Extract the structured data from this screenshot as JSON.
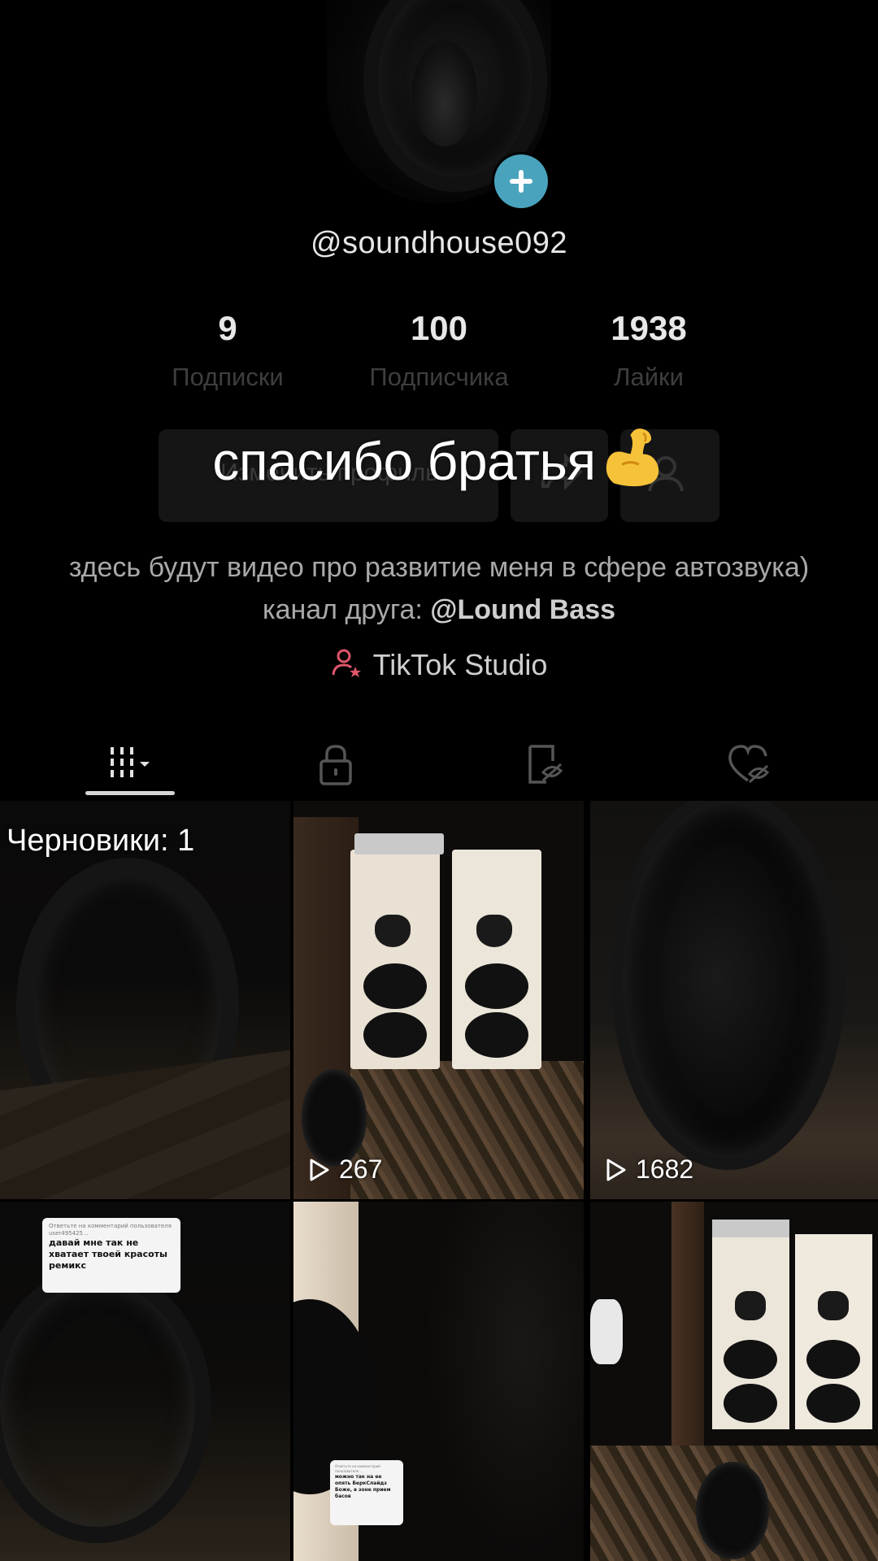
{
  "profile": {
    "username": "@soundhouse092",
    "stats": [
      {
        "value": "9",
        "label": "Подписки"
      },
      {
        "value": "100",
        "label": "Подписчика"
      },
      {
        "value": "1938",
        "label": "Лайки"
      }
    ],
    "edit_profile_label": "Изменить профиль",
    "overlay_caption": "спасибо братья",
    "bio_text": "здесь будут видео про развитие меня в сфере автозвука) канал друга: ",
    "bio_mention": "@Lound Bass",
    "studio_label": "TikTok Studio"
  },
  "tabs": [
    {
      "icon": "videos-grid-icon",
      "active": true
    },
    {
      "icon": "lock-icon",
      "active": false
    },
    {
      "icon": "reposts-icon",
      "active": false
    },
    {
      "icon": "liked-hidden-icon",
      "active": false
    }
  ],
  "grid": {
    "drafts_label": "Черновики: 1",
    "videos": [
      {
        "views": "267"
      },
      {
        "views": "1682"
      }
    ],
    "reply_card_1": {
      "header": "Ответьте на комментарий пользователя user495425...",
      "body": "давай мне так не хватает твоей красоты ремикс"
    },
    "reply_card_2": {
      "header": "Ответьте на комментарий пользователя ...",
      "body": "можно так на ее опять БеркСлайдз Боже, в зоне прием басов"
    }
  },
  "colors": {
    "background": "#000000",
    "add_badge": "#4aa3bd",
    "studio_icon": "#e0566a"
  }
}
